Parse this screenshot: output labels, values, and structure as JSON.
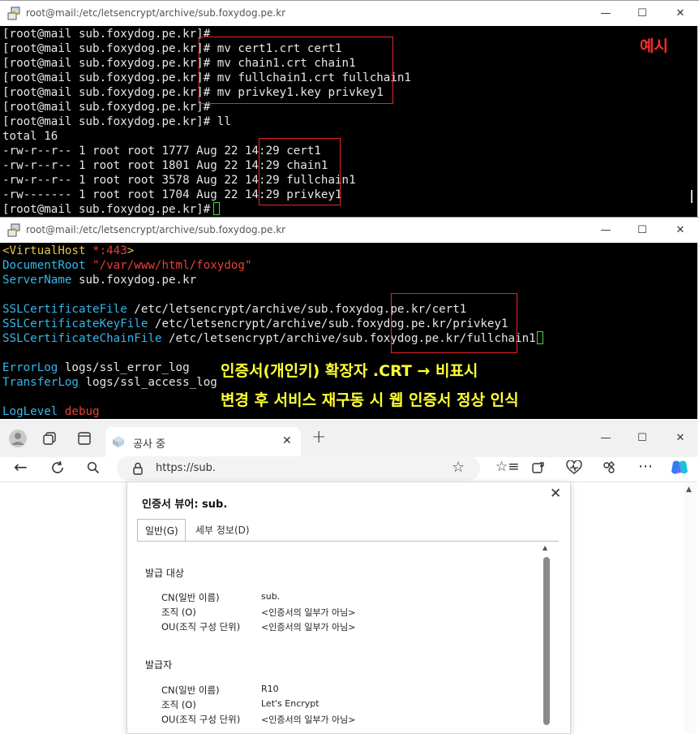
{
  "terminal1": {
    "title": "root@mail:/etc/letsencrypt/archive/sub.foxydog.pe.kr",
    "lines": [
      "[root@mail sub.foxydog.pe.kr]#",
      "[root@mail sub.foxydog.pe.kr]# mv cert1.crt cert1",
      "[root@mail sub.foxydog.pe.kr]# mv chain1.crt chain1",
      "[root@mail sub.foxydog.pe.kr]# mv fullchain1.crt fullchain1",
      "[root@mail sub.foxydog.pe.kr]# mv privkey1.key privkey1",
      "[root@mail sub.foxydog.pe.kr]#",
      "[root@mail sub.foxydog.pe.kr]# ll",
      "total 16",
      "-rw-r--r-- 1 root root 1777 Aug 22 14:29 cert1",
      "-rw-r--r-- 1 root root 1801 Aug 22 14:29 chain1",
      "-rw-r--r-- 1 root root 3578 Aug 22 14:29 fullchain1",
      "-rw------- 1 root root 1704 Aug 22 14:29 privkey1",
      "[root@mail sub.foxydog.pe.kr]#"
    ],
    "annotation": "예시"
  },
  "terminal2": {
    "title": "root@mail:/etc/letsencrypt/archive/sub.foxydog.pe.kr",
    "vhost_open": "<VirtualHost ",
    "vhost_addr": "*:443",
    "vhost_close": ">",
    "docroot_key": "DocumentRoot",
    "docroot_val": "\"/var/www/html/foxydog\"",
    "servername_key": "ServerName",
    "servername_val": " sub.foxydog.pe.kr",
    "certfile_key": "SSLCertificateFile",
    "certfile_val": " /etc/letsencrypt/archive/sub.foxydog.pe.kr/cert1",
    "keyfile_key": "SSLCertificateKeyFile",
    "keyfile_val": " /etc/letsencrypt/archive/sub.foxydog.pe.kr/privkey1",
    "chainfile_key": "SSLCertificateChainFile",
    "chainfile_val": " /etc/letsencrypt/archive/sub.foxydog.pe.kr/fullchain1",
    "errorlog_key": "ErrorLog",
    "errorlog_val": " logs/ssl_error_log",
    "transferlog_key": "TransferLog",
    "transferlog_val": " logs/ssl_access_log",
    "loglevel_key": "LogLevel",
    "loglevel_val": " debug",
    "annotation_line1": "인증서(개인키) 확장자 .CRT → 비표시",
    "annotation_line2": "변경 후 서비스 재구동 시 웹 인증서 정상 인식"
  },
  "browser": {
    "tab_title": "공사 중",
    "url": "https://sub."
  },
  "cert_dialog": {
    "title": "인증서 뷰어: sub.",
    "tabs": [
      "일반(G)",
      "세부 정보(D)"
    ],
    "issued_to_heading": "발급 대상",
    "issued_to": [
      {
        "label": "CN(일반 이름)",
        "value": "sub."
      },
      {
        "label": "조직 (O)",
        "value": "<인증서의 일부가 아님>"
      },
      {
        "label": "OU(조직 구성 단위)",
        "value": "<인증서의 일부가 아님>"
      }
    ],
    "issuer_heading": "발급자",
    "issuer": [
      {
        "label": "CN(일반 이름)",
        "value": "R10"
      },
      {
        "label": "조직 (O)",
        "value": "Let's Encrypt"
      },
      {
        "label": "OU(조직 구성 단위)",
        "value": "<인증서의 일부가 아님>"
      }
    ]
  },
  "colors": {
    "highlight_box": "#e8262b",
    "annotation_red": "#ff2a2a",
    "annotation_yellow": "#ffff33"
  }
}
